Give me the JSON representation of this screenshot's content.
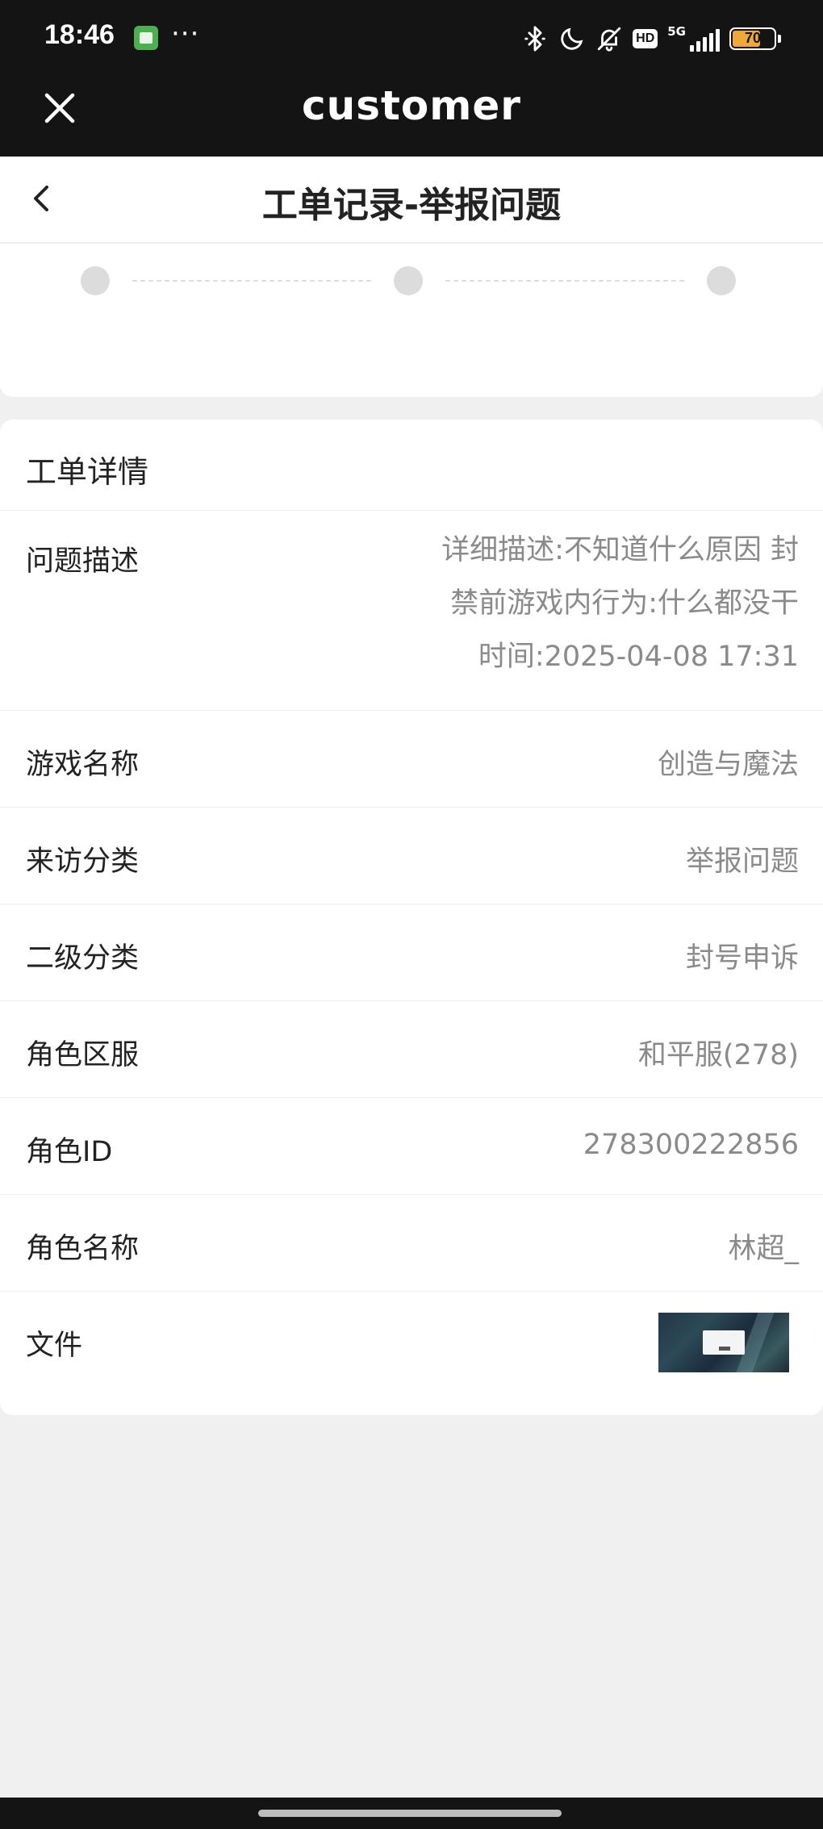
{
  "status_bar": {
    "time": "18:46",
    "more_dots": "···",
    "hd_label": "HD",
    "network_label": "5G",
    "battery_level": "70",
    "battery_fraction": 0.7,
    "battery_color": "#f0a83a",
    "icons": [
      "gallery-app-icon",
      "bluetooth-icon",
      "moon-icon",
      "bell-off-icon",
      "signal-icon",
      "battery-icon"
    ]
  },
  "app_bar": {
    "title": "customer",
    "close_icon": "close-icon"
  },
  "header": {
    "title": "工单记录-举报问题",
    "back_icon": "chevron-left-icon"
  },
  "progress_steps": {
    "count": 3,
    "dot_color": "#dcdcdc"
  },
  "detail": {
    "title": "工单详情",
    "description": {
      "label": "问题描述",
      "lines": [
        "详细描述:不知道什么原因 封",
        "禁前游戏内行为:什么都没干",
        "时间:2025-04-08 17:31"
      ]
    },
    "rows": [
      {
        "label": "游戏名称",
        "value": "创造与魔法"
      },
      {
        "label": "来访分类",
        "value": "举报问题"
      },
      {
        "label": "二级分类",
        "value": "封号申诉"
      },
      {
        "label": "角色区服",
        "value": "和平服(278)"
      },
      {
        "label": "角色ID",
        "value": "278300222856"
      },
      {
        "label": "角色名称",
        "value": "林超_"
      }
    ],
    "file": {
      "label": "文件",
      "thumbnail": "screenshot-thumbnail"
    }
  },
  "colors": {
    "bar_bg": "#141414",
    "page_bg": "#f0f0f0",
    "label": "#222222",
    "value": "#8a8a8a"
  }
}
